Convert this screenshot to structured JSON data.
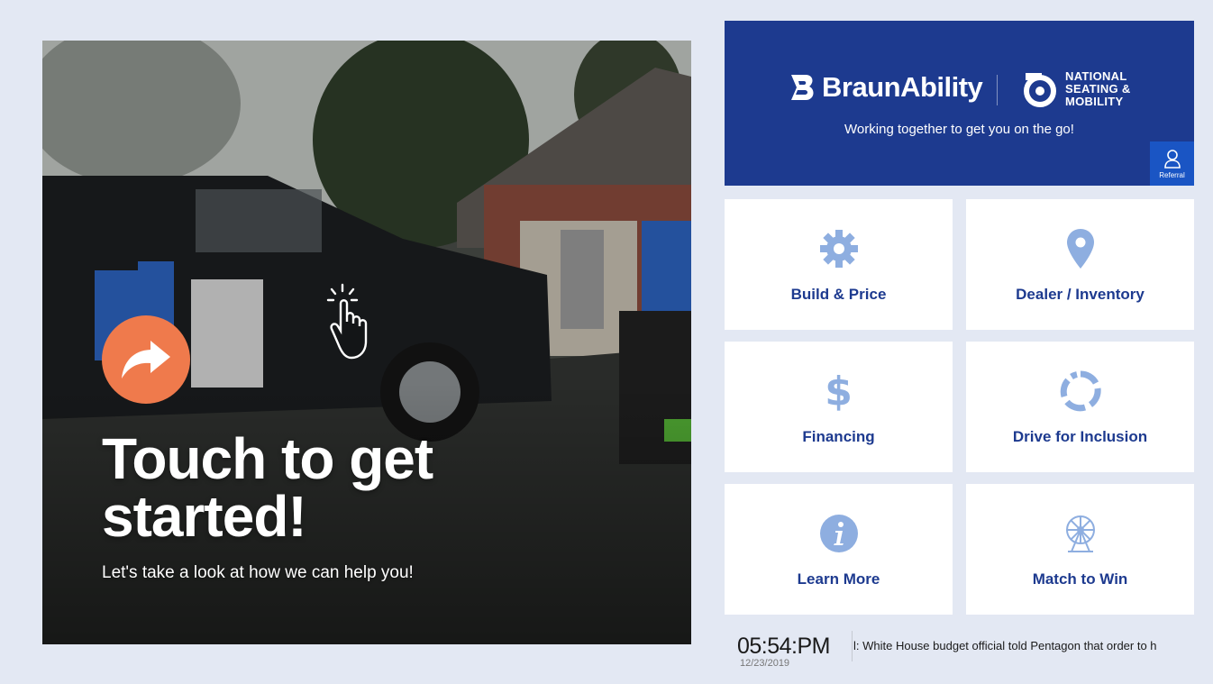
{
  "hero": {
    "title": "Touch to get started!",
    "subtitle": "Let's take a look at how we can help you!"
  },
  "brand": {
    "logo_primary": "BraunAbility",
    "logo_secondary_line1": "NATIONAL",
    "logo_secondary_line2": "SEATING &",
    "logo_secondary_line3": "MOBILITY",
    "tagline": "Working together to get you on the go!",
    "referral_label": "Referral",
    "color_primary": "#1d3a8f",
    "color_accent": "#ef7a4c"
  },
  "tiles": [
    {
      "label": "Build & Price",
      "icon": "gear-icon"
    },
    {
      "label": "Dealer / Inventory",
      "icon": "map-pin-icon"
    },
    {
      "label": "Financing",
      "icon": "dollar-icon"
    },
    {
      "label": "Drive for Inclusion",
      "icon": "ring-icon"
    },
    {
      "label": "Learn More",
      "icon": "info-icon"
    },
    {
      "label": "Match to Win",
      "icon": "ferris-wheel-icon"
    }
  ],
  "clock": {
    "time": "05:54:PM",
    "date": "12/23/2019"
  },
  "ticker": {
    "text": "l: White House budget official told Pentagon that order to h"
  }
}
